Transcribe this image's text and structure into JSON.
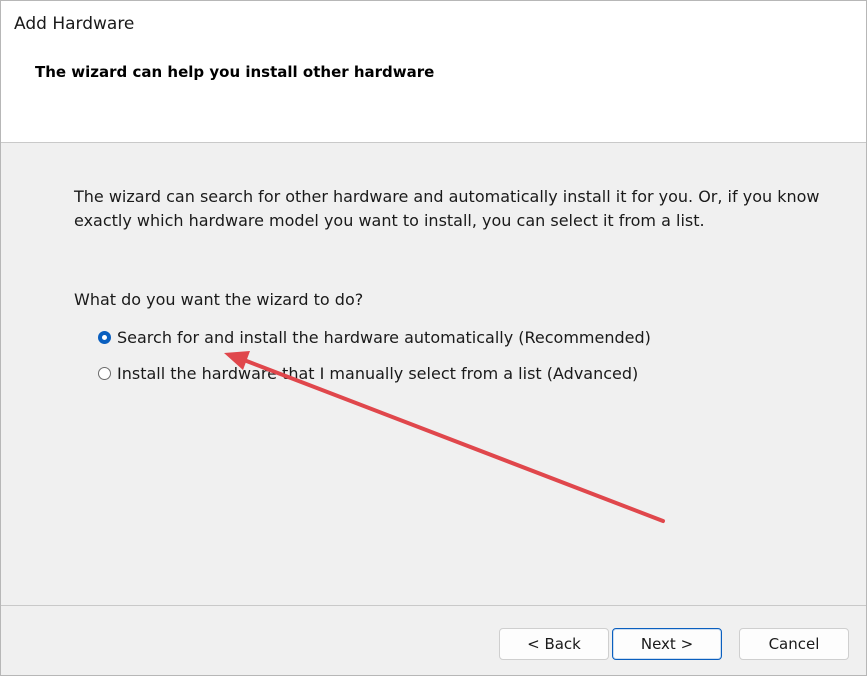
{
  "window": {
    "title": "Add Hardware",
    "subtitle": "The wizard can help you install other hardware"
  },
  "body": {
    "description": "The wizard can search for other hardware and automatically install it for you. Or, if you know exactly which hardware model you want to install, you can select it from a list.",
    "question": "What do you want the wizard to do?",
    "options": [
      {
        "label": "Search for and install the hardware automatically (Recommended)",
        "selected": true
      },
      {
        "label": "Install the hardware that I manually select from a list (Advanced)",
        "selected": false
      }
    ]
  },
  "buttons": {
    "back": "< Back",
    "next": "Next >",
    "cancel": "Cancel"
  },
  "annotation": {
    "arrow_color": "#e0474c",
    "accent": "#0a5fbf"
  }
}
